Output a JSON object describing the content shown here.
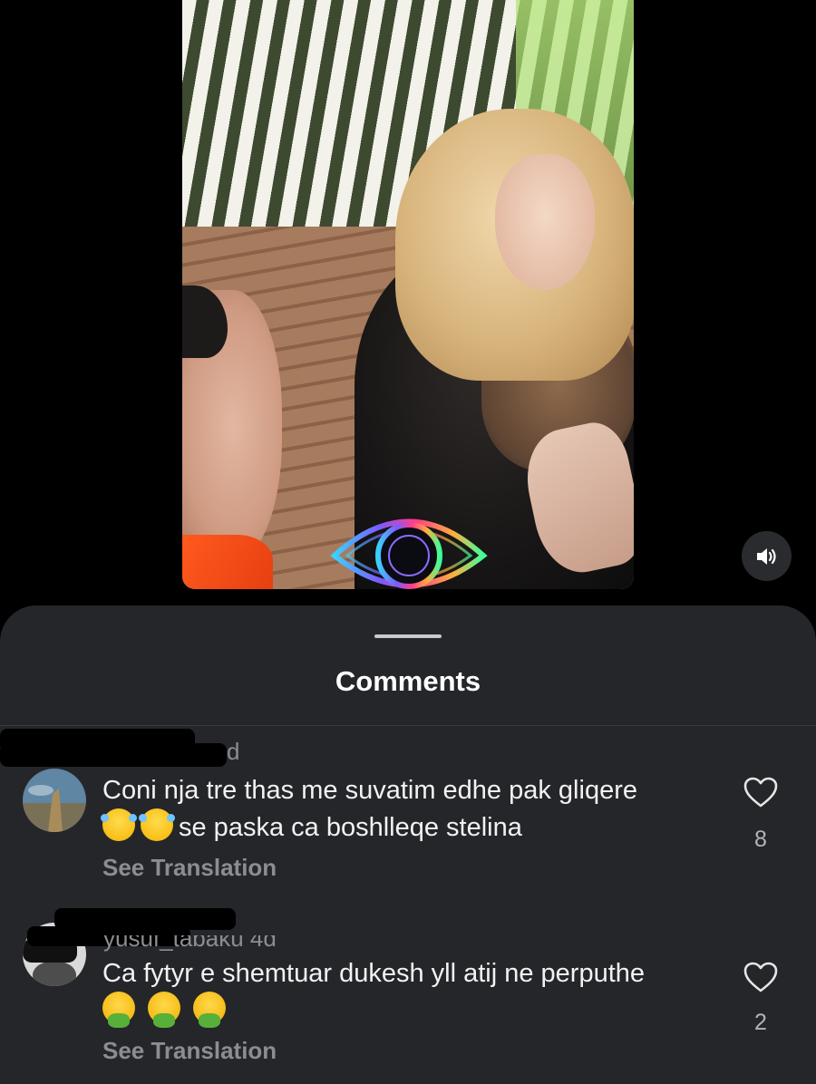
{
  "video": {
    "volume_icon": "speaker-volume-icon",
    "overlay_logo": "eye-logo"
  },
  "comments_sheet": {
    "title": "Comments",
    "comments": [
      {
        "username_visible": "d",
        "text_line1": "Coni nja tre thas me suvatim edhe pak gliqere",
        "text_line2": "se paska ca boshlleqe stelina",
        "emoji": "face-with-tears-of-joy-icon",
        "see_translation": "See Translation",
        "likes": "8"
      },
      {
        "username_visible": "yusuf_tabaku 4d",
        "text_line1": "Ca fytyr e shemtuar dukesh yll atij ne perputhe",
        "emoji": "vomiting-face-icon",
        "see_translation": "See Translation",
        "likes": "2"
      }
    ]
  },
  "colors": {
    "background": "#000000",
    "sheet": "#25262a",
    "secondary_text": "#8c8d91"
  }
}
